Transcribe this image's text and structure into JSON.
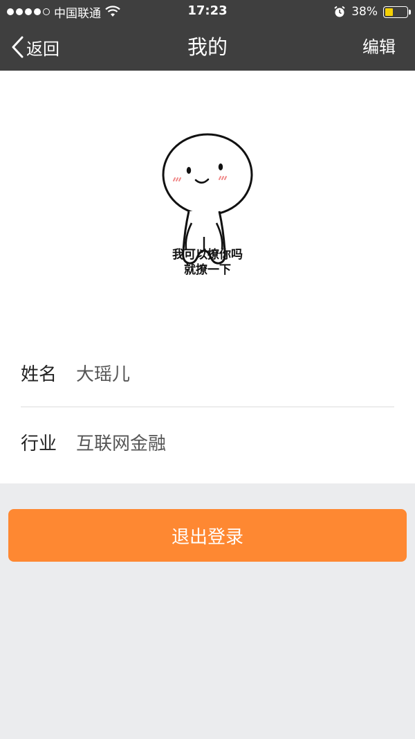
{
  "status_bar": {
    "carrier": "中国联通",
    "time": "17:23",
    "battery_percent": "38%",
    "battery_level": 0.38,
    "battery_color": "#f5d104"
  },
  "nav": {
    "back_label": "返回",
    "title": "我的",
    "edit_label": "编辑"
  },
  "profile": {
    "avatar_caption_line1": "我可以撩你吗",
    "avatar_caption_line2": "就撩一下",
    "fields": [
      {
        "label": "姓名",
        "value": "大瑶儿"
      },
      {
        "label": "行业",
        "value": "互联网金融"
      }
    ]
  },
  "actions": {
    "logout_label": "退出登录"
  },
  "colors": {
    "nav_bg": "#3f3f3f",
    "accent": "#fe8832",
    "page_bg": "#ebecee"
  },
  "icons": [
    "signal-dots-icon",
    "wifi-icon",
    "alarm-icon",
    "battery-icon",
    "chevron-left-icon"
  ]
}
